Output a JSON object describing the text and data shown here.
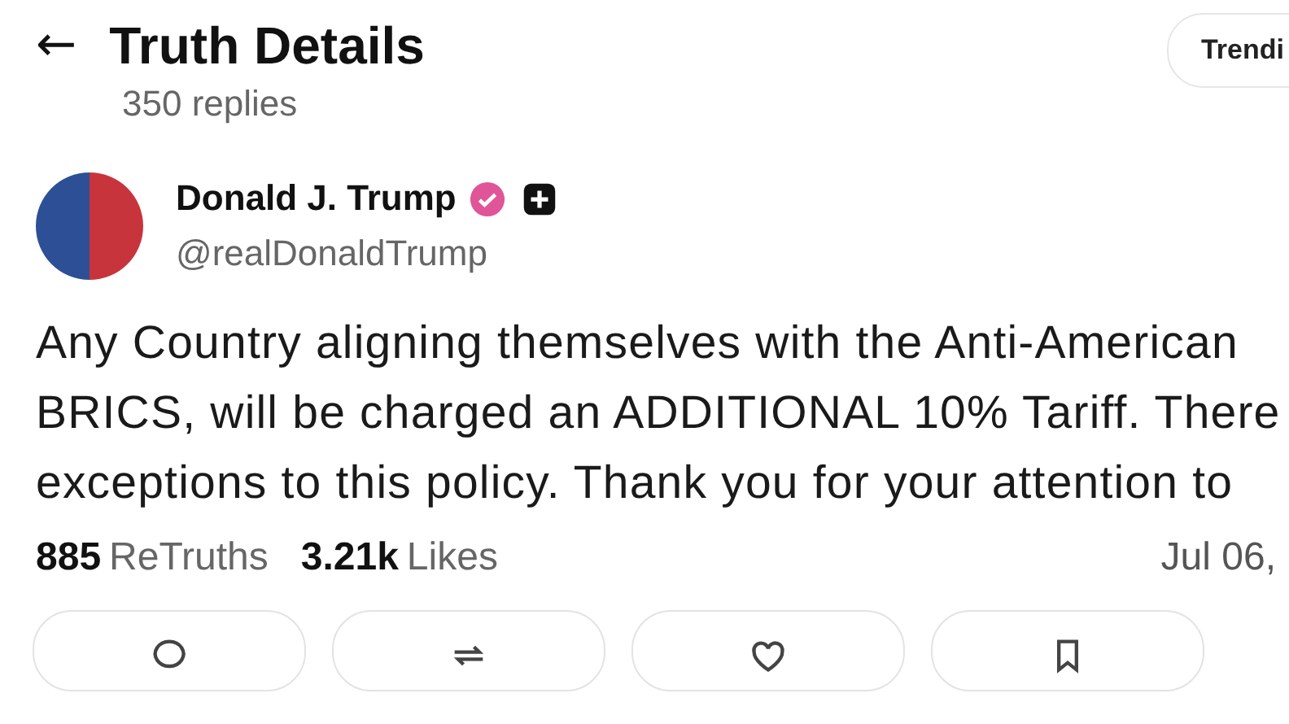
{
  "header": {
    "back": "←",
    "title": "Truth Details",
    "replies": "350 replies",
    "pill": "Trendi"
  },
  "post": {
    "author": {
      "name": "Donald J. Trump",
      "verified": true,
      "handle": "@realDonaldTrump"
    },
    "text_lines": [
      "Any Country aligning themselves with the Anti-American",
      "BRICS, will be charged an ADDITIONAL 10% Tariff. There",
      "exceptions to this policy. Thank you for your attention to"
    ],
    "stats": [
      {
        "count": "885",
        "label": "ReTruths"
      },
      {
        "count": "3.21k",
        "label": "Likes"
      }
    ],
    "date": "Jul 06,",
    "actions": [
      {
        "kind": "reply"
      },
      {
        "kind": "retruth"
      },
      {
        "kind": "like"
      },
      {
        "kind": "bookmark"
      }
    ]
  }
}
